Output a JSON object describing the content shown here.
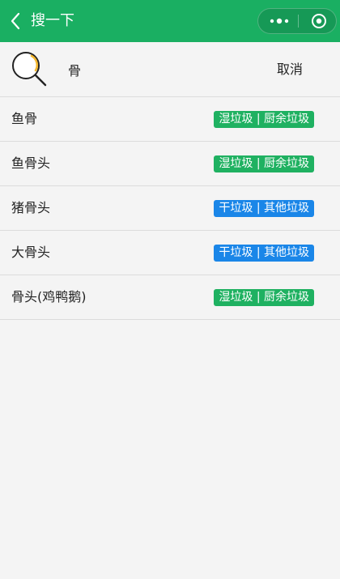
{
  "header": {
    "title": "搜一下",
    "bg_color": "#1aaf62",
    "back_icon": "chevron-left-icon",
    "more_icon": "more-dots-icon",
    "close_icon": "target-circle-icon"
  },
  "search": {
    "value": "骨",
    "cancel_label": "取消",
    "icon": "magnifier-icon"
  },
  "colors": {
    "wet": "#1fb161",
    "dry": "#1a86e8"
  },
  "results": [
    {
      "name": "鱼骨",
      "category": "湿垃圾 | 厨余垃圾",
      "type": "wet"
    },
    {
      "name": "鱼骨头",
      "category": "湿垃圾 | 厨余垃圾",
      "type": "wet"
    },
    {
      "name": "猪骨头",
      "category": "干垃圾 | 其他垃圾",
      "type": "dry"
    },
    {
      "name": "大骨头",
      "category": "干垃圾 | 其他垃圾",
      "type": "dry"
    },
    {
      "name": "骨头(鸡鸭鹅)",
      "category": "湿垃圾 | 厨余垃圾",
      "type": "wet"
    }
  ]
}
